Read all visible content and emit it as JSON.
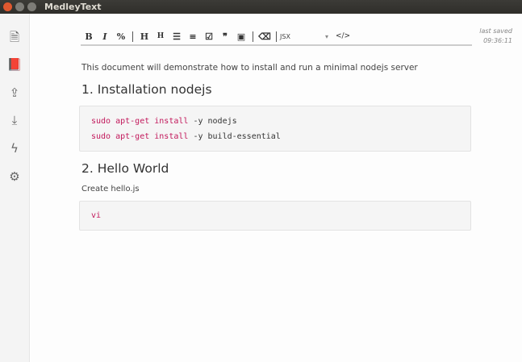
{
  "window": {
    "title": "MedleyText"
  },
  "sidebar": {
    "items": [
      {
        "icon": "document-icon"
      },
      {
        "icon": "book-icon"
      },
      {
        "icon": "upload-icon"
      },
      {
        "icon": "download-icon"
      },
      {
        "icon": "lightning-icon"
      },
      {
        "icon": "gear-icon"
      }
    ]
  },
  "toolbar": {
    "bold": "B",
    "italic": "I",
    "link": "%",
    "h1": "H",
    "h2": "H",
    "ul": "☰",
    "ol": "≡",
    "check": "☑",
    "quote": "❞",
    "image": "▣",
    "eraser": "⌫",
    "language": "JSX",
    "caret": "▾",
    "code": "</>"
  },
  "status": {
    "label": "last saved",
    "time": "09:36:11"
  },
  "doc": {
    "intro": "This document will demonstrate how to install and run a minimal nodejs server",
    "h1": "1. Installation nodejs",
    "code1": [
      {
        "k": "sudo apt-get install",
        "r": " -y nodejs"
      },
      {
        "k": "sudo apt-get install",
        "r": " -y build-essential"
      }
    ],
    "h2": "2. Hello World",
    "p2": "Create hello.js",
    "code2": [
      {
        "k": "vi",
        "r": ""
      }
    ]
  }
}
